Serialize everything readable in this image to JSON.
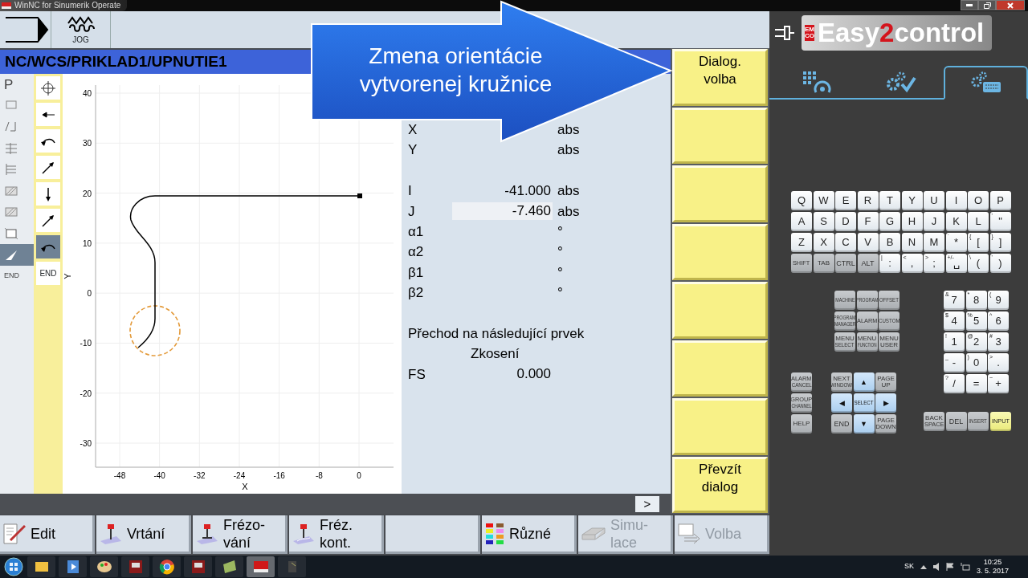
{
  "window": {
    "title": "WinNC for Sinumerik Operate"
  },
  "header": {
    "mode": "JOG"
  },
  "path": "NC/WCS/PRIKLAD1/UPNUTIE1",
  "callout": {
    "lines": [
      "Zmena orientácie",
      "vytvorenej kružnice"
    ]
  },
  "left_items": [
    {
      "text": "P",
      "selected": false
    },
    {
      "selected": false
    },
    {
      "selected": false
    },
    {
      "selected": false
    },
    {
      "selected": false
    },
    {
      "selected": false
    },
    {
      "selected": false
    },
    {
      "selected": false
    },
    {
      "selected": true
    },
    {
      "text": "END",
      "selected": false
    }
  ],
  "contour_items": [
    {
      "selected": false
    },
    {
      "selected": false
    },
    {
      "selected": false
    },
    {
      "selected": false
    },
    {
      "selected": false
    },
    {
      "selected": false
    },
    {
      "selected": true
    },
    {
      "text": "END",
      "selected": false
    }
  ],
  "plot": {
    "xlabel": "X",
    "ylabel": "Y",
    "xticks": [
      "-48",
      "-40",
      "-32",
      "-24",
      "-16",
      "-8",
      "0"
    ],
    "yticks": [
      "40",
      "30",
      "20",
      "10",
      "0",
      "-10",
      "-20",
      "-30"
    ]
  },
  "fields": [
    {
      "kind": "field",
      "label": "X",
      "unit": "abs",
      "selected": false
    },
    {
      "kind": "field",
      "label": "Y",
      "unit": "abs",
      "selected": false
    },
    {
      "kind": "gap"
    },
    {
      "kind": "field",
      "label": "I",
      "value": "-41.000",
      "unit": "abs",
      "selected": false
    },
    {
      "kind": "field",
      "label": "J",
      "value": "-7.460",
      "unit": "abs",
      "selected": true
    },
    {
      "kind": "field",
      "label": "α1",
      "unit": "°",
      "selected": false
    },
    {
      "kind": "field",
      "label": "α2",
      "unit": "°",
      "selected": false
    },
    {
      "kind": "field",
      "label": "β1",
      "unit": "°",
      "selected": false
    },
    {
      "kind": "field",
      "label": "β2",
      "unit": "°",
      "selected": false
    },
    {
      "kind": "gap"
    },
    {
      "kind": "text",
      "text": "Přechod na následující prvek"
    },
    {
      "kind": "center",
      "text": "Zkosení"
    },
    {
      "kind": "field",
      "label": "FS",
      "value": "0.000",
      "selected": false
    }
  ],
  "more_button": ">",
  "vertical_softkeys": [
    {
      "kind": "label",
      "lines": [
        "Dialog.",
        "volba"
      ]
    },
    {
      "kind": "blank"
    },
    {
      "kind": "blank"
    },
    {
      "kind": "blank"
    },
    {
      "kind": "blank"
    },
    {
      "kind": "blank"
    },
    {
      "kind": "blank"
    },
    {
      "kind": "label",
      "lines": [
        "Převzít",
        "dialog"
      ]
    }
  ],
  "horizontal_softkeys": [
    {
      "kind": "label",
      "lines": [
        "Edit"
      ],
      "disabled": false
    },
    {
      "kind": "label",
      "lines": [
        "Vrtání"
      ],
      "disabled": false
    },
    {
      "kind": "label",
      "lines": [
        "Frézo-",
        "vání"
      ],
      "disabled": false
    },
    {
      "kind": "label",
      "lines": [
        "Fréz.",
        "kont."
      ],
      "disabled": false
    },
    {
      "kind": "blank"
    },
    {
      "kind": "label",
      "lines": [
        "Různé"
      ],
      "disabled": false
    },
    {
      "kind": "label",
      "lines": [
        "Simu-",
        "lace"
      ],
      "disabled": true
    },
    {
      "kind": "label",
      "lines": [
        "Volba"
      ],
      "disabled": true
    }
  ],
  "panel": {
    "logo": {
      "brand": "EMCO",
      "parts": [
        "Easy",
        "2",
        "control"
      ]
    },
    "tabs": [
      {
        "selected": false
      },
      {
        "selected": false
      },
      {
        "selected": true
      }
    ]
  },
  "letter_keys": [
    [
      {
        "kind": "char",
        "label": "Q"
      },
      {
        "kind": "char",
        "label": "W"
      },
      {
        "kind": "char",
        "label": "E"
      },
      {
        "kind": "char",
        "label": "R"
      },
      {
        "kind": "char",
        "label": "T"
      },
      {
        "kind": "char",
        "label": "Y"
      },
      {
        "kind": "char",
        "label": "U"
      },
      {
        "kind": "char",
        "label": "I"
      },
      {
        "kind": "char",
        "label": "O"
      },
      {
        "kind": "char",
        "label": "P"
      }
    ],
    [
      {
        "kind": "char",
        "label": "A"
      },
      {
        "kind": "char",
        "label": "S"
      },
      {
        "kind": "char",
        "label": "D"
      },
      {
        "kind": "char",
        "label": "F"
      },
      {
        "kind": "char",
        "label": "G"
      },
      {
        "kind": "char",
        "label": "H"
      },
      {
        "kind": "char",
        "label": "J"
      },
      {
        "kind": "char",
        "label": "K"
      },
      {
        "kind": "char",
        "label": "L"
      },
      {
        "kind": "char",
        "label": "\"",
        "sub": "'"
      }
    ],
    [
      {
        "kind": "char",
        "label": "Z"
      },
      {
        "kind": "char",
        "label": "X"
      },
      {
        "kind": "char",
        "label": "C"
      },
      {
        "kind": "char",
        "label": "V"
      },
      {
        "kind": "char",
        "label": "B"
      },
      {
        "kind": "char",
        "label": "N"
      },
      {
        "kind": "char",
        "label": "M"
      },
      {
        "kind": "char",
        "label": "*",
        "sub": "`"
      },
      {
        "kind": "char",
        "label": "[",
        "sub": "{"
      },
      {
        "kind": "char",
        "label": "]",
        "sub": "}"
      }
    ],
    [
      {
        "kind": "function",
        "caption": "SHIFT"
      },
      {
        "kind": "function",
        "caption": "TAB"
      },
      {
        "kind": "function",
        "label": "CTRL"
      },
      {
        "kind": "function",
        "label": "ALT"
      },
      {
        "kind": "char",
        "label": ":",
        "sub": "|"
      },
      {
        "kind": "char",
        "label": ",",
        "sub": "<"
      },
      {
        "kind": "char",
        "label": ";",
        "sub": ">"
      },
      {
        "kind": "char",
        "label": "␣",
        "sub": "+/-"
      },
      {
        "kind": "char",
        "label": "(",
        "sub": "\\"
      },
      {
        "kind": "char",
        "label": ")",
        "sub": "'"
      }
    ]
  ],
  "function_keys": [
    [
      {
        "kind": "function",
        "caption": "MACHINE"
      },
      {
        "kind": "function",
        "caption": "PROGRAM"
      },
      {
        "kind": "function",
        "caption": "OFFSET"
      }
    ],
    [
      {
        "kind": "function",
        "caption": "PROGRAM MANAGER"
      },
      {
        "kind": "function",
        "caption": "ALARM"
      },
      {
        "kind": "function",
        "caption": "CUSTOM"
      }
    ],
    [
      {
        "kind": "function",
        "caption": "MENU SELECT"
      },
      {
        "kind": "function",
        "caption": "MENU FUNCTION"
      },
      {
        "kind": "function",
        "caption": "MENU USER"
      }
    ]
  ],
  "numpad_keys": [
    [
      {
        "kind": "char",
        "label": "7",
        "sub": "&"
      },
      {
        "kind": "char",
        "label": "8",
        "sub": "*"
      },
      {
        "kind": "char",
        "label": "9",
        "sub": "("
      }
    ],
    [
      {
        "kind": "char",
        "label": "4",
        "sub": "$"
      },
      {
        "kind": "char",
        "label": "5",
        "sub": "%"
      },
      {
        "kind": "char",
        "label": "6",
        "sub": "^"
      }
    ],
    [
      {
        "kind": "char",
        "label": "1",
        "sub": "!"
      },
      {
        "kind": "char",
        "label": "2",
        "sub": "@"
      },
      {
        "kind": "char",
        "label": "3",
        "sub": "#"
      }
    ],
    [
      {
        "kind": "char",
        "label": "-",
        "sub": "_"
      },
      {
        "kind": "char",
        "label": "0",
        "sub": ")"
      },
      {
        "kind": "char",
        "label": ".",
        "sub": ">"
      }
    ],
    [
      {
        "kind": "char",
        "label": "/",
        "sub": "?"
      },
      {
        "kind": "char",
        "label": "="
      },
      {
        "kind": "char",
        "label": "+",
        "sub": "~"
      }
    ]
  ],
  "side_keys": [
    {
      "kind": "function",
      "caption": "ALARM CANCEL"
    },
    {
      "kind": "function",
      "caption": "GROUP CHANNEL"
    },
    {
      "kind": "function",
      "caption": "HELP"
    }
  ],
  "cursor_keys": [
    [
      {
        "kind": "function",
        "caption": "NEXT WINDOW"
      },
      {
        "kind": "cursor",
        "label": "▲"
      },
      {
        "kind": "function",
        "caption": "PAGE UP"
      }
    ],
    [
      {
        "kind": "cursor",
        "label": "◀"
      },
      {
        "kind": "cursor",
        "caption": "SELECT"
      },
      {
        "kind": "cursor",
        "label": "▶"
      }
    ],
    [
      {
        "kind": "function",
        "label": "END"
      },
      {
        "kind": "cursor",
        "label": "▼"
      },
      {
        "kind": "function",
        "caption": "PAGE DOWN"
      }
    ]
  ],
  "edit_keys": [
    {
      "kind": "function",
      "caption": "BACK SPACE"
    },
    {
      "kind": "function",
      "label": "DEL"
    },
    {
      "kind": "function",
      "caption": "INSERT"
    },
    {
      "kind": "enter",
      "caption": "INPUT"
    }
  ],
  "taskbar": {
    "apps": [
      {
        "active": false
      },
      {
        "active": false
      },
      {
        "active": false
      },
      {
        "active": false
      },
      {
        "active": false
      },
      {
        "active": false
      },
      {
        "active": false
      },
      {
        "active": true
      },
      {
        "active": false
      }
    ],
    "language": "SK",
    "time": "10:25",
    "date": "3. 5. 2017"
  }
}
